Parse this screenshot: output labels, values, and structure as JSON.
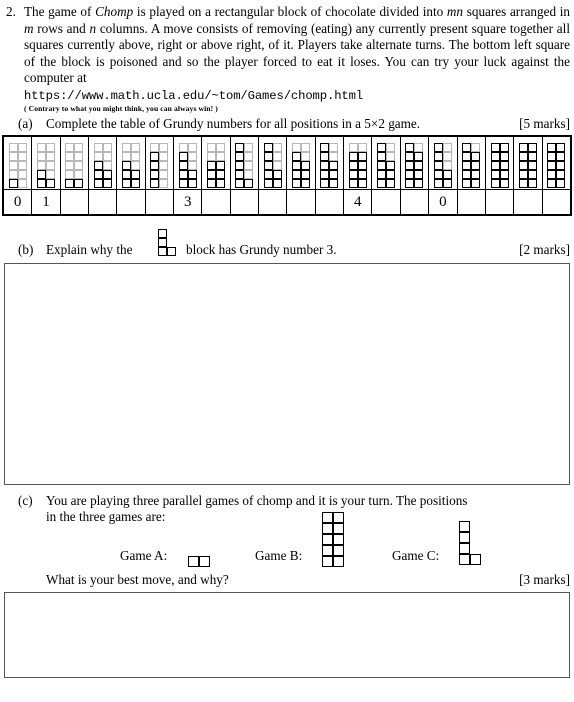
{
  "question": {
    "number": "2.",
    "stem_parts": [
      "The game of ",
      "Chomp",
      " is played on a rectangular block of chocolate divided into ",
      "mn",
      " squares arranged in ",
      "m",
      " rows and ",
      "n",
      " columns.  A move consists of removing (eating) any currently present square together all squares currently above, right or above right, of it.  Players take alternate turns.  The bottom left square of the block is poisoned and so the player forced to eat it loses.  You can try your luck against the computer at"
    ],
    "url": "https://www.math.ucla.edu/~tom/Games/chomp.html",
    "parenthetical": "( Contrary to what you might think, you can always win! )"
  },
  "part_a": {
    "label": "(a)",
    "text_before": "Complete the table of Grundy numbers for all positions in a 5",
    "times": "×",
    "text_after": "2 game.",
    "marks": "[5 marks]",
    "grid_rows": 5,
    "grid_cols": 2,
    "cells": [
      {
        "shape": [
          [
            1,
            0
          ],
          [
            0,
            0
          ],
          [
            0,
            0
          ],
          [
            0,
            0
          ],
          [
            0,
            0
          ]
        ],
        "value": "0"
      },
      {
        "shape": [
          [
            1,
            1
          ],
          [
            1,
            0
          ],
          [
            0,
            0
          ],
          [
            0,
            0
          ],
          [
            0,
            0
          ]
        ],
        "value": "1"
      },
      {
        "shape": [
          [
            1,
            1
          ],
          [
            0,
            0
          ],
          [
            0,
            0
          ],
          [
            0,
            0
          ],
          [
            0,
            0
          ]
        ],
        "value": ""
      },
      {
        "shape": [
          [
            1,
            1
          ],
          [
            1,
            1
          ],
          [
            1,
            0
          ],
          [
            0,
            0
          ],
          [
            0,
            0
          ]
        ],
        "value": ""
      },
      {
        "shape": [
          [
            1,
            1
          ],
          [
            1,
            1
          ],
          [
            1,
            0
          ],
          [
            0,
            0
          ],
          [
            0,
            0
          ]
        ],
        "value": ""
      },
      {
        "shape": [
          [
            1,
            0
          ],
          [
            1,
            0
          ],
          [
            1,
            0
          ],
          [
            1,
            0
          ],
          [
            0,
            0
          ]
        ],
        "value": ""
      },
      {
        "shape": [
          [
            1,
            1
          ],
          [
            1,
            1
          ],
          [
            1,
            0
          ],
          [
            1,
            0
          ],
          [
            0,
            0
          ]
        ],
        "value": "3"
      },
      {
        "shape": [
          [
            1,
            1
          ],
          [
            1,
            1
          ],
          [
            1,
            1
          ],
          [
            0,
            0
          ],
          [
            0,
            0
          ]
        ],
        "value": ""
      },
      {
        "shape": [
          [
            1,
            1
          ],
          [
            1,
            0
          ],
          [
            1,
            0
          ],
          [
            1,
            0
          ],
          [
            1,
            0
          ]
        ],
        "value": ""
      },
      {
        "shape": [
          [
            1,
            1
          ],
          [
            1,
            1
          ],
          [
            1,
            0
          ],
          [
            1,
            0
          ],
          [
            1,
            0
          ]
        ],
        "value": ""
      },
      {
        "shape": [
          [
            1,
            1
          ],
          [
            1,
            1
          ],
          [
            1,
            1
          ],
          [
            1,
            0
          ],
          [
            0,
            0
          ]
        ],
        "value": ""
      },
      {
        "shape": [
          [
            1,
            1
          ],
          [
            1,
            1
          ],
          [
            1,
            1
          ],
          [
            1,
            0
          ],
          [
            1,
            0
          ]
        ],
        "value": ""
      },
      {
        "shape": [
          [
            1,
            1
          ],
          [
            1,
            1
          ],
          [
            1,
            1
          ],
          [
            1,
            1
          ],
          [
            0,
            0
          ]
        ],
        "value": "4"
      },
      {
        "shape": [
          [
            1,
            1
          ],
          [
            1,
            1
          ],
          [
            1,
            1
          ],
          [
            1,
            0
          ],
          [
            1,
            0
          ]
        ],
        "value": ""
      },
      {
        "shape": [
          [
            1,
            1
          ],
          [
            1,
            1
          ],
          [
            1,
            1
          ],
          [
            1,
            1
          ],
          [
            1,
            0
          ]
        ],
        "value": ""
      },
      {
        "shape": [
          [
            1,
            1
          ],
          [
            1,
            1
          ],
          [
            1,
            0
          ],
          [
            1,
            0
          ],
          [
            1,
            0
          ]
        ],
        "value": "0"
      },
      {
        "shape": [
          [
            1,
            1
          ],
          [
            1,
            1
          ],
          [
            1,
            1
          ],
          [
            1,
            1
          ],
          [
            1,
            0
          ]
        ],
        "value": ""
      },
      {
        "shape": [
          [
            1,
            1
          ],
          [
            1,
            1
          ],
          [
            1,
            1
          ],
          [
            1,
            1
          ],
          [
            1,
            1
          ]
        ],
        "value": ""
      },
      {
        "shape": [
          [
            1,
            1
          ],
          [
            1,
            1
          ],
          [
            1,
            1
          ],
          [
            1,
            1
          ],
          [
            1,
            1
          ]
        ],
        "value": ""
      },
      {
        "shape": [
          [
            1,
            1
          ],
          [
            1,
            1
          ],
          [
            1,
            1
          ],
          [
            1,
            1
          ],
          [
            1,
            1
          ]
        ],
        "value": ""
      }
    ]
  },
  "part_b": {
    "label": "(b)",
    "text_before": "Explain why the",
    "text_after": "block has Grundy number 3.",
    "marks": "[2 marks]",
    "shape": [
      [
        1,
        1
      ],
      [
        1,
        0
      ],
      [
        1,
        0
      ]
    ]
  },
  "part_c": {
    "label": "(c)",
    "line1": "You are playing three parallel games of chomp and it is your turn.  The positions",
    "line2": "in the three games are:",
    "question": "What is your best move, and why?",
    "marks": "[3 marks]",
    "games": [
      {
        "label": "Game A:",
        "shape": [
          [
            1,
            1
          ]
        ]
      },
      {
        "label": "Game B:",
        "shape": [
          [
            1,
            1
          ],
          [
            1,
            1
          ],
          [
            1,
            1
          ],
          [
            1,
            1
          ],
          [
            1,
            1
          ]
        ]
      },
      {
        "label": "Game C:",
        "shape": [
          [
            1,
            1
          ],
          [
            1,
            0
          ],
          [
            1,
            0
          ],
          [
            1,
            0
          ]
        ]
      }
    ]
  },
  "colors": {
    "ink": "#000000",
    "ghost_grid": "#b8b8b8",
    "box_border": "#555555"
  }
}
